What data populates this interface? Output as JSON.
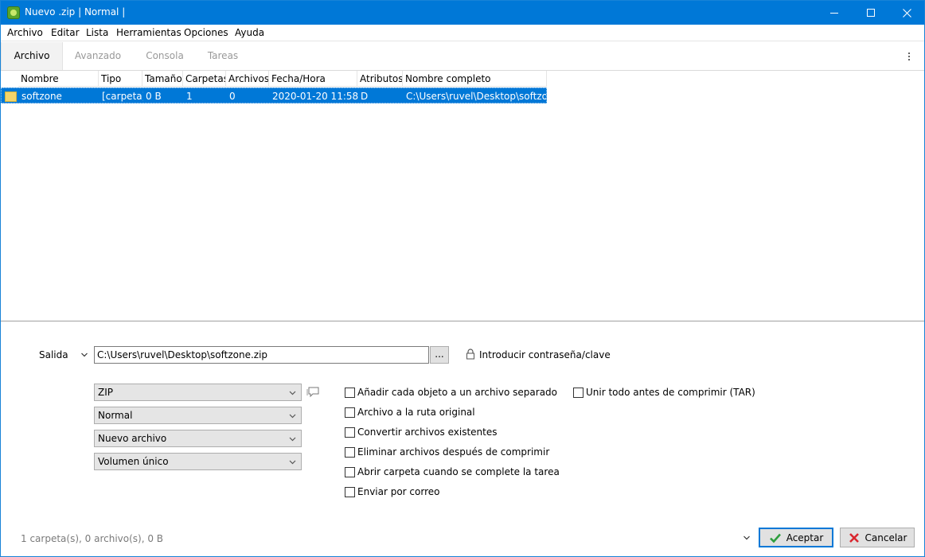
{
  "window": {
    "title": "Nuevo .zip | Normal |",
    "icons": {
      "app": "app-icon",
      "minimize": "minimize-icon",
      "maximize": "maximize-icon",
      "close": "close-icon"
    },
    "accent_color": "#0078d7"
  },
  "menu": {
    "items": [
      "Archivo",
      "Editar",
      "Lista",
      "Herramientas",
      "Opciones",
      "Ayuda"
    ]
  },
  "tabs": {
    "items": [
      "Archivo",
      "Avanzado",
      "Consola",
      "Tareas"
    ],
    "active": "Archivo"
  },
  "list": {
    "columns": [
      "Nombre",
      "Tipo",
      "Tamaño",
      "Carpetas",
      "Archivos",
      "Fecha/Hora",
      "Atributos",
      "Nombre completo"
    ],
    "rows": [
      {
        "icon": "folder-icon",
        "nombre": "softzone",
        "tipo": "[carpeta]",
        "tamano": "0 B",
        "carpetas": "1",
        "archivos": "0",
        "fecha": "2020-01-20 11:58:10",
        "atributos": "D",
        "nombre_completo": "C:\\Users\\ruvel\\Desktop\\softzone",
        "selected": true
      }
    ]
  },
  "output": {
    "label": "Salida",
    "path": "C:\\Users\\ruvel\\Desktop\\softzone.zip",
    "browse_label": "...",
    "password_label": "Introducir contraseña/clave"
  },
  "selects": {
    "format": "ZIP",
    "level": "Normal",
    "mode": "Nuevo archivo",
    "volume": "Volumen único"
  },
  "options": {
    "add_separate": {
      "label": "Añadir cada objeto a un archivo separado",
      "checked": false
    },
    "original_path": {
      "label": "Archivo a la ruta original",
      "checked": false
    },
    "convert_existing": {
      "label": "Convertir archivos existentes",
      "checked": false
    },
    "delete_after": {
      "label": "Eliminar archivos después de comprimir",
      "checked": false
    },
    "open_folder": {
      "label": "Abrir carpeta cuando se complete la tarea",
      "checked": false
    },
    "send_mail": {
      "label": "Enviar por correo",
      "checked": false
    },
    "tar_join": {
      "label": "Unir todo antes de comprimir (TAR)",
      "checked": false
    }
  },
  "status": "1 carpeta(s), 0 archivo(s), 0 B",
  "buttons": {
    "accept": "Aceptar",
    "cancel": "Cancelar"
  }
}
